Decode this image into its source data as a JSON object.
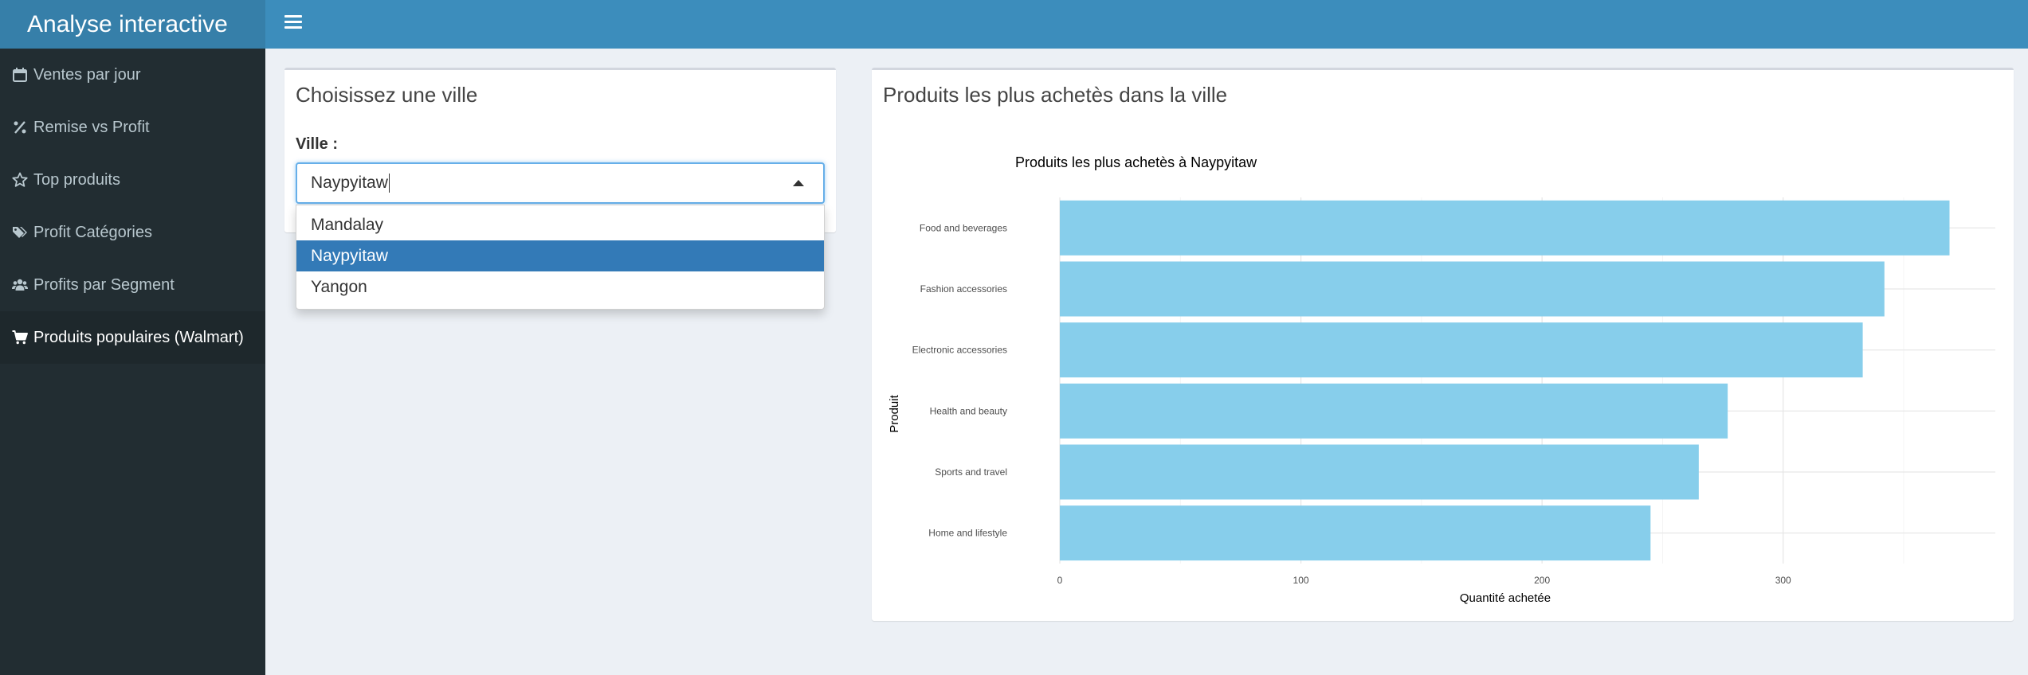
{
  "header": {
    "title": "Analyse interactive"
  },
  "sidebar": {
    "items": [
      {
        "label": "Ventes par jour",
        "icon": "calendar-icon",
        "active": false
      },
      {
        "label": "Remise vs Profit",
        "icon": "percent-icon",
        "active": false
      },
      {
        "label": "Top produits",
        "icon": "star-icon",
        "active": false
      },
      {
        "label": "Profit Catégories",
        "icon": "tags-icon",
        "active": false
      },
      {
        "label": "Profits par Segment",
        "icon": "users-icon",
        "active": false
      },
      {
        "label": "Produits populaires (Walmart)",
        "icon": "shopping-cart-icon",
        "active": true
      }
    ]
  },
  "city_box": {
    "title": "Choisissez une ville",
    "label": "Ville :",
    "selected": "Naypyitaw",
    "options": [
      "Mandalay",
      "Naypyitaw",
      "Yangon"
    ]
  },
  "plot_box": {
    "title": "Produits les plus achetès dans la ville"
  },
  "colors": {
    "bar": "#87ceeb",
    "header": "#3c8dbc",
    "logo": "#367fa9",
    "sidebar": "#222d32",
    "selected_option": "#337ab7"
  },
  "chart_data": {
    "type": "bar",
    "orientation": "horizontal",
    "title": "Produits les plus achetès à Naypyitaw",
    "xlabel": "Quantité achetée",
    "ylabel": "Produit",
    "categories": [
      "Food and beverages",
      "Fashion accessories",
      "Electronic accessories",
      "Health and beauty",
      "Sports and travel",
      "Home and lifestyle"
    ],
    "values": [
      369,
      342,
      333,
      277,
      265,
      245
    ],
    "xlim": [
      0,
      388
    ],
    "xticks": [
      0,
      100,
      200,
      300
    ],
    "grid": true
  }
}
